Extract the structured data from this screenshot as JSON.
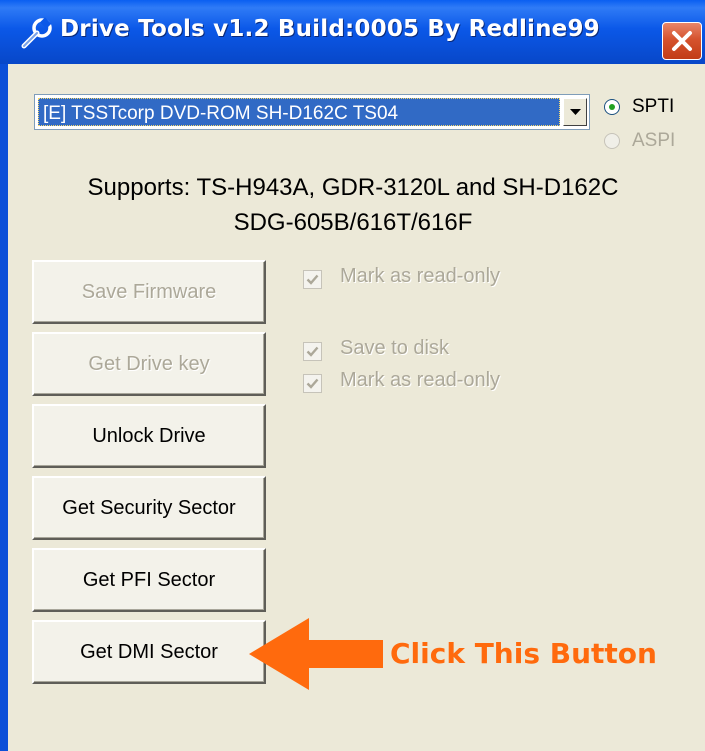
{
  "window": {
    "title": "Drive Tools v1.2 Build:0005 By Redline99",
    "title_icon": "wrench-icon",
    "close_icon": "close-icon"
  },
  "drive": {
    "selected": "[E] TSSTcorp DVD-ROM SH-D162C TS04",
    "dropdown_icon": "chevron-down-icon"
  },
  "interface": {
    "options": [
      {
        "label": "SPTI",
        "selected": true,
        "enabled": true
      },
      {
        "label": "ASPI",
        "selected": false,
        "enabled": false
      }
    ]
  },
  "supports": {
    "line1": "Supports: TS-H943A, GDR-3120L and SH-D162C",
    "line2": "SDG-605B/616T/616F"
  },
  "buttons": {
    "save_firmware": "Save Firmware",
    "get_drive_key": "Get Drive key",
    "unlock_drive": "Unlock Drive",
    "get_security_sector": "Get Security Sector",
    "get_pfi_sector": "Get PFI Sector",
    "get_dmi_sector": "Get DMI Sector"
  },
  "checkboxes": {
    "firmware_readonly": "Mark as read-only",
    "save_to_disk": "Save to disk",
    "key_readonly": "Mark as read-only"
  },
  "annotation": {
    "text": "Click This Button",
    "color": "#ff6a0d",
    "icon": "arrow-left-icon"
  },
  "colors": {
    "titlebar": "#0b58e8",
    "dialog_bg": "#ece9d8",
    "selection": "#316ac5",
    "disabled_text": "#aca899"
  }
}
